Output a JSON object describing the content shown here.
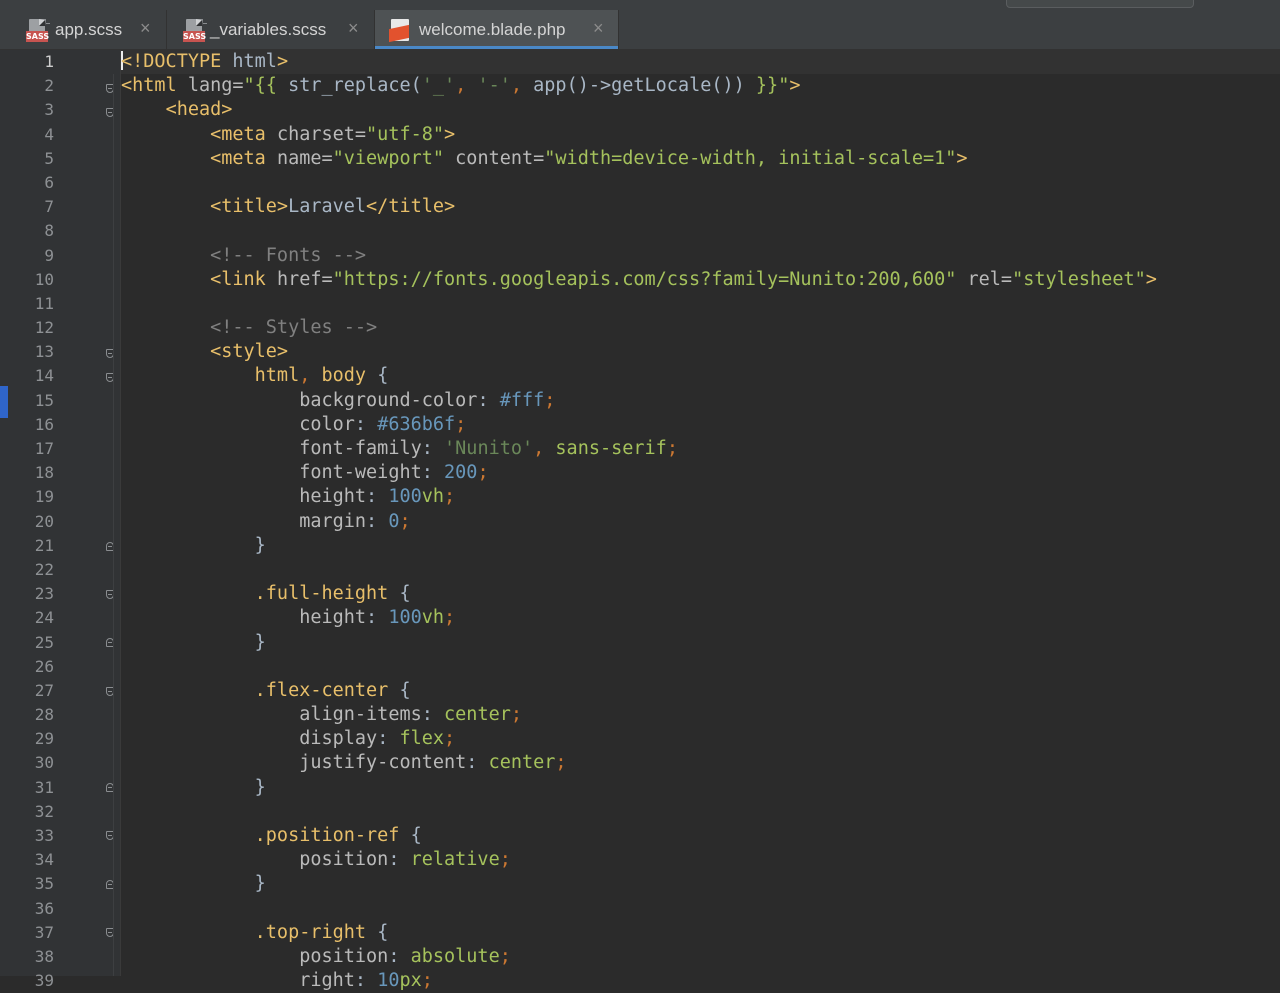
{
  "tabs": [
    {
      "label": "app.scss",
      "icon": "sass-file-icon",
      "active": false
    },
    {
      "label": "_variables.scss",
      "icon": "sass-file-icon",
      "active": false
    },
    {
      "label": "welcome.blade.php",
      "icon": "blade-file-icon",
      "active": true
    }
  ],
  "sass_badge": "SASS",
  "close_glyph": "×",
  "line_numbers": [
    "1",
    "2",
    "3",
    "4",
    "5",
    "6",
    "7",
    "8",
    "9",
    "10",
    "11",
    "12",
    "13",
    "14",
    "15",
    "16",
    "17",
    "18",
    "19",
    "20",
    "21",
    "22",
    "23",
    "24",
    "25",
    "26",
    "27",
    "28",
    "29",
    "30",
    "31",
    "32",
    "33",
    "34",
    "35",
    "36",
    "37",
    "38",
    "39"
  ],
  "code_lines": [
    [
      [
        "t",
        "<!DOCTYPE "
      ],
      [
        "d",
        "html"
      ],
      [
        "t",
        ">"
      ]
    ],
    [
      [
        "t",
        "<html "
      ],
      [
        "a",
        "lang="
      ],
      [
        "s",
        "\"{{ "
      ],
      [
        "d",
        "str_replace("
      ],
      [
        "q",
        "'_'"
      ],
      [
        "o",
        ", "
      ],
      [
        "q",
        "'-'"
      ],
      [
        "o",
        ", "
      ],
      [
        "d",
        "app()->getLocale()) "
      ],
      [
        "s",
        "}}\""
      ],
      [
        "t",
        ">"
      ]
    ],
    [
      [
        "d",
        "    "
      ],
      [
        "t",
        "<head>"
      ]
    ],
    [
      [
        "d",
        "        "
      ],
      [
        "t",
        "<meta "
      ],
      [
        "a",
        "charset="
      ],
      [
        "s",
        "\"utf-8\""
      ],
      [
        "t",
        ">"
      ]
    ],
    [
      [
        "d",
        "        "
      ],
      [
        "t",
        "<meta "
      ],
      [
        "a",
        "name="
      ],
      [
        "s",
        "\"viewport\" "
      ],
      [
        "a",
        "content="
      ],
      [
        "s",
        "\"width=device-width, initial-scale=1\""
      ],
      [
        "t",
        ">"
      ]
    ],
    [],
    [
      [
        "d",
        "        "
      ],
      [
        "t",
        "<title>"
      ],
      [
        "d",
        "Laravel"
      ],
      [
        "t",
        "</title>"
      ]
    ],
    [],
    [
      [
        "d",
        "        "
      ],
      [
        "c",
        "<!-- Fonts -->"
      ]
    ],
    [
      [
        "d",
        "        "
      ],
      [
        "t",
        "<link "
      ],
      [
        "a",
        "href="
      ],
      [
        "s",
        "\"https://fonts.googleapis.com/css?family=Nunito:200,600\" "
      ],
      [
        "a",
        "rel="
      ],
      [
        "s",
        "\"stylesheet\""
      ],
      [
        "t",
        ">"
      ]
    ],
    [],
    [
      [
        "d",
        "        "
      ],
      [
        "c",
        "<!-- Styles -->"
      ]
    ],
    [
      [
        "d",
        "        "
      ],
      [
        "t",
        "<style>"
      ]
    ],
    [
      [
        "d",
        "            "
      ],
      [
        "sel",
        "html"
      ],
      [
        "o",
        ", "
      ],
      [
        "sel",
        "body "
      ],
      [
        "d",
        "{"
      ]
    ],
    [
      [
        "d",
        "                "
      ],
      [
        "p",
        "background-color"
      ],
      [
        "d",
        ": "
      ],
      [
        "n",
        "#fff"
      ],
      [
        "o",
        ";"
      ]
    ],
    [
      [
        "d",
        "                "
      ],
      [
        "p",
        "color"
      ],
      [
        "d",
        ": "
      ],
      [
        "n",
        "#636b6f"
      ],
      [
        "o",
        ";"
      ]
    ],
    [
      [
        "d",
        "                "
      ],
      [
        "p",
        "font-family"
      ],
      [
        "d",
        ": "
      ],
      [
        "q",
        "'Nunito'"
      ],
      [
        "o",
        ", "
      ],
      [
        "k",
        "sans-serif"
      ],
      [
        "o",
        ";"
      ]
    ],
    [
      [
        "d",
        "                "
      ],
      [
        "p",
        "font-weight"
      ],
      [
        "d",
        ": "
      ],
      [
        "n",
        "200"
      ],
      [
        "o",
        ";"
      ]
    ],
    [
      [
        "d",
        "                "
      ],
      [
        "p",
        "height"
      ],
      [
        "d",
        ": "
      ],
      [
        "n",
        "100"
      ],
      [
        "k",
        "vh"
      ],
      [
        "o",
        ";"
      ]
    ],
    [
      [
        "d",
        "                "
      ],
      [
        "p",
        "margin"
      ],
      [
        "d",
        ": "
      ],
      [
        "n",
        "0"
      ],
      [
        "o",
        ";"
      ]
    ],
    [
      [
        "d",
        "            }"
      ]
    ],
    [],
    [
      [
        "d",
        "            "
      ],
      [
        "sel",
        ".full-height "
      ],
      [
        "d",
        "{"
      ]
    ],
    [
      [
        "d",
        "                "
      ],
      [
        "p",
        "height"
      ],
      [
        "d",
        ": "
      ],
      [
        "n",
        "100"
      ],
      [
        "k",
        "vh"
      ],
      [
        "o",
        ";"
      ]
    ],
    [
      [
        "d",
        "            }"
      ]
    ],
    [],
    [
      [
        "d",
        "            "
      ],
      [
        "sel",
        ".flex-center "
      ],
      [
        "d",
        "{"
      ]
    ],
    [
      [
        "d",
        "                "
      ],
      [
        "p",
        "align-items"
      ],
      [
        "d",
        ": "
      ],
      [
        "k",
        "center"
      ],
      [
        "o",
        ";"
      ]
    ],
    [
      [
        "d",
        "                "
      ],
      [
        "p",
        "display"
      ],
      [
        "d",
        ": "
      ],
      [
        "k",
        "flex"
      ],
      [
        "o",
        ";"
      ]
    ],
    [
      [
        "d",
        "                "
      ],
      [
        "p",
        "justify-content"
      ],
      [
        "d",
        ": "
      ],
      [
        "k",
        "center"
      ],
      [
        "o",
        ";"
      ]
    ],
    [
      [
        "d",
        "            }"
      ]
    ],
    [],
    [
      [
        "d",
        "            "
      ],
      [
        "sel",
        ".position-ref "
      ],
      [
        "d",
        "{"
      ]
    ],
    [
      [
        "d",
        "                "
      ],
      [
        "p",
        "position"
      ],
      [
        "d",
        ": "
      ],
      [
        "k",
        "relative"
      ],
      [
        "o",
        ";"
      ]
    ],
    [
      [
        "d",
        "            }"
      ]
    ],
    [],
    [
      [
        "d",
        "            "
      ],
      [
        "sel",
        ".top-right "
      ],
      [
        "d",
        "{"
      ]
    ],
    [
      [
        "d",
        "                "
      ],
      [
        "p",
        "position"
      ],
      [
        "d",
        ": "
      ],
      [
        "k",
        "absolute"
      ],
      [
        "o",
        ";"
      ]
    ],
    [
      [
        "d",
        "                "
      ],
      [
        "p",
        "right"
      ],
      [
        "d",
        ": "
      ],
      [
        "n",
        "10"
      ],
      [
        "k",
        "px"
      ],
      [
        "o",
        ";"
      ]
    ]
  ],
  "colors": {
    "background": "#2b2b2b",
    "gutter": "#313335",
    "tab_active_underline": "#4a88c7",
    "tag": "#e8bf6a",
    "string": "#a5c25c",
    "comment": "#808080",
    "number": "#6897bb"
  }
}
